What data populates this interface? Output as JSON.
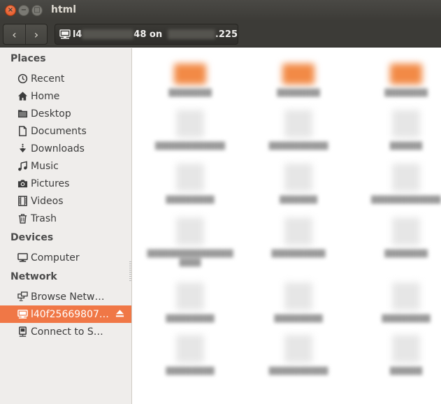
{
  "window": {
    "title": "html",
    "close_glyph": "×",
    "minimize_glyph": "−",
    "maximize_glyph": "□"
  },
  "toolbar": {
    "back_glyph": "‹",
    "forward_glyph": "›",
    "path": {
      "prefix": "l4",
      "middle": "48 on",
      "suffix": ".225"
    }
  },
  "sidebar": {
    "sections": {
      "places": "Places",
      "devices": "Devices",
      "network": "Network"
    },
    "places": [
      {
        "label": "Recent",
        "icon": "clock-icon"
      },
      {
        "label": "Home",
        "icon": "home-icon"
      },
      {
        "label": "Desktop",
        "icon": "folder-icon"
      },
      {
        "label": "Documents",
        "icon": "document-icon"
      },
      {
        "label": "Downloads",
        "icon": "download-icon"
      },
      {
        "label": "Music",
        "icon": "music-icon"
      },
      {
        "label": "Pictures",
        "icon": "camera-icon"
      },
      {
        "label": "Videos",
        "icon": "film-icon"
      },
      {
        "label": "Trash",
        "icon": "trash-icon"
      }
    ],
    "devices": [
      {
        "label": "Computer",
        "icon": "computer-icon"
      }
    ],
    "network": [
      {
        "label": "Browse Network",
        "icon": "network-icon"
      },
      {
        "label": "l40f25669807…",
        "icon": "network-share-icon",
        "selected": true
      },
      {
        "label": "Connect to Server",
        "icon": "server-icon"
      }
    ]
  },
  "colors": {
    "accent": "#f07746",
    "titlebar": "#3c3b37",
    "sidebar_bg": "#efedeb",
    "folder": "#f28a46"
  }
}
